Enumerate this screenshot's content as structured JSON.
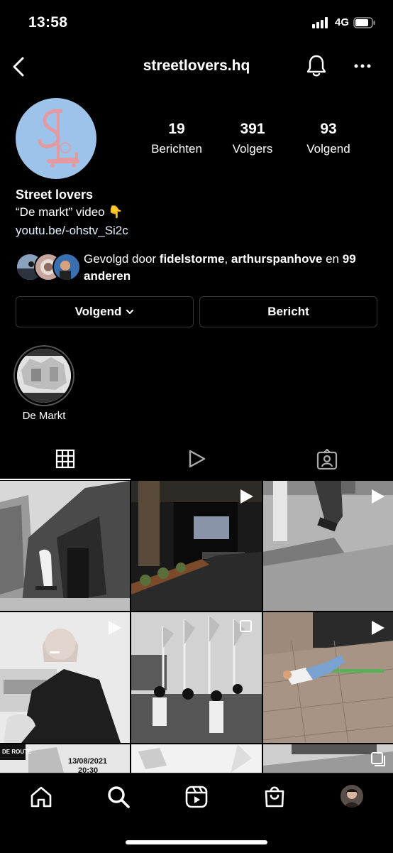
{
  "status_bar": {
    "time": "13:58",
    "network": "4G"
  },
  "header": {
    "username": "streetlovers.hq"
  },
  "profile": {
    "stats": [
      {
        "value": "19",
        "label": "Berichten"
      },
      {
        "value": "391",
        "label": "Volgers"
      },
      {
        "value": "93",
        "label": "Volgend"
      }
    ],
    "name": "Street lovers",
    "bio_line": "“De markt” video 👇",
    "link": "youtu.be/-ohstv_Si2c",
    "followed_by": {
      "prefix": "Gevolgd door ",
      "user1": "fidelstorme",
      "separator": ", ",
      "user2": "arthurspanhove",
      "conjunction": " en ",
      "others": "99 anderen"
    }
  },
  "buttons": {
    "following_label": "Volgend",
    "message_label": "Bericht"
  },
  "highlights": [
    {
      "label": "De Markt"
    }
  ],
  "grid": {
    "row3_texts": {
      "poster_title": "DE ROUTE",
      "poster_date": "13/08/2021",
      "poster_time": "20:30"
    }
  },
  "colors": {
    "background": "#000000",
    "avatar": "#9ec3ea",
    "avatar_logo": "#e39aa0",
    "border": "#363636"
  }
}
